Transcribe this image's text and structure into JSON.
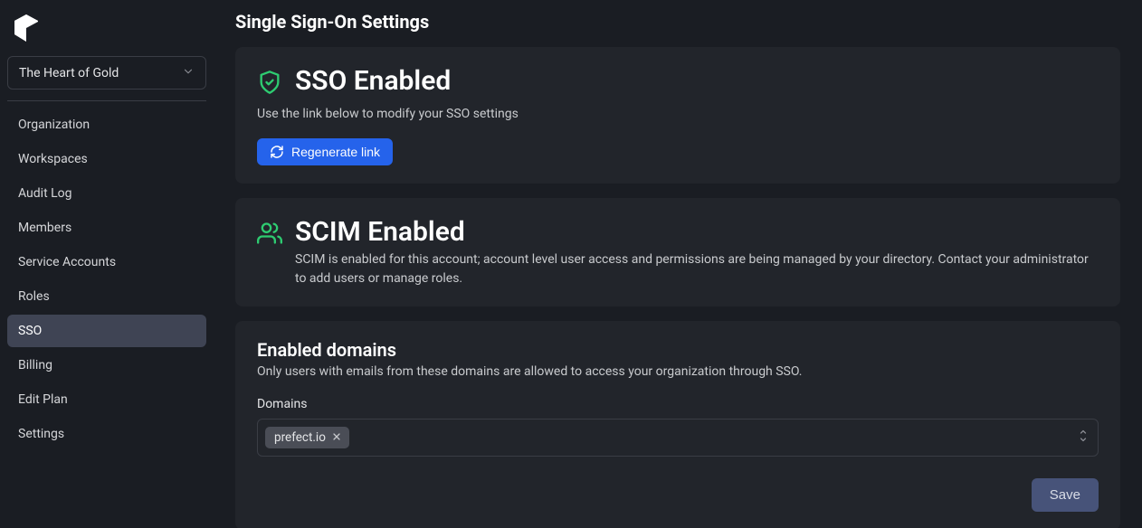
{
  "org_name": "The Heart of Gold",
  "sidebar": {
    "items": [
      {
        "label": "Organization"
      },
      {
        "label": "Workspaces"
      },
      {
        "label": "Audit Log"
      },
      {
        "label": "Members"
      },
      {
        "label": "Service Accounts"
      },
      {
        "label": "Roles"
      },
      {
        "label": "SSO"
      },
      {
        "label": "Billing"
      },
      {
        "label": "Edit Plan"
      },
      {
        "label": "Settings"
      }
    ],
    "active_index": 6
  },
  "page": {
    "title": "Single Sign-On Settings"
  },
  "sso_card": {
    "title": "SSO Enabled",
    "description": "Use the link below to modify your SSO settings",
    "regenerate_label": "Regenerate link"
  },
  "scim_card": {
    "title": "SCIM Enabled",
    "description": "SCIM is enabled for this account; account level user access and permissions are being managed by your directory. Contact your administrator to add users or manage roles."
  },
  "domains_card": {
    "title": "Enabled domains",
    "description": "Only users with emails from these domains are allowed to access your organization through SSO.",
    "field_label": "Domains",
    "chips": [
      {
        "label": "prefect.io"
      }
    ],
    "save_label": "Save"
  }
}
